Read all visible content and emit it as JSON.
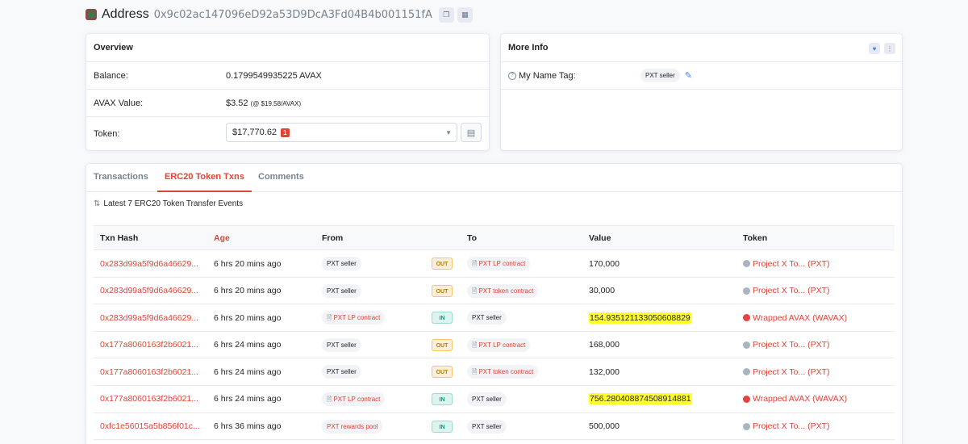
{
  "header": {
    "title": "Address",
    "address": "0x9c02ac147096eD92a53D9DcA3Fd04B4b001151fA"
  },
  "overview": {
    "title": "Overview",
    "balance_label": "Balance:",
    "balance_value": "0.1799549935225 AVAX",
    "avax_value_label": "AVAX Value:",
    "avax_value": "$3.52",
    "avax_rate": "(@ $19.58/AVAX)",
    "token_label": "Token:",
    "token_value": "$17,770.62",
    "token_count": "1"
  },
  "more_info": {
    "title": "More Info",
    "name_tag_label": "My Name Tag:",
    "name_tag_value": "PXT seller"
  },
  "tabs": [
    {
      "label": "Transactions"
    },
    {
      "label": "ERC20 Token Txns",
      "active": true
    },
    {
      "label": "Comments"
    }
  ],
  "latest_text": "Latest 7 ERC20 Token Transfer Events",
  "table": {
    "headers": [
      "Txn Hash",
      "Age",
      "From",
      "To",
      "Value",
      "Token"
    ],
    "rows": [
      {
        "hash": "0x283d99a5f9d6a46629...",
        "age": "6 hrs 20 mins ago",
        "from": "PXT seller",
        "dir": "OUT",
        "to": "PXT LP contract",
        "value": "170,000",
        "token": "Project X To... (PXT)"
      },
      {
        "hash": "0x283d99a5f9d6a46629...",
        "age": "6 hrs 20 mins ago",
        "from": "PXT seller",
        "dir": "OUT",
        "to": "PXT token contract",
        "value": "30,000",
        "token": "Project X To... (PXT)"
      },
      {
        "hash": "0x283d99a5f9d6a46629...",
        "age": "6 hrs 20 mins ago",
        "from": "PXT LP contract",
        "dir": "IN",
        "to": "PXT seller",
        "value": "154.935121133050608829",
        "token": "Wrapped AVAX (WAVAX)"
      },
      {
        "hash": "0x177a8060163f2b6021...",
        "age": "6 hrs 24 mins ago",
        "from": "PXT seller",
        "dir": "OUT",
        "to": "PXT LP contract",
        "value": "168,000",
        "token": "Project X To... (PXT)"
      },
      {
        "hash": "0x177a8060163f2b6021...",
        "age": "6 hrs 24 mins ago",
        "from": "PXT seller",
        "dir": "OUT",
        "to": "PXT token contract",
        "value": "132,000",
        "token": "Project X To... (PXT)"
      },
      {
        "hash": "0x177a8060163f2b6021...",
        "age": "6 hrs 24 mins ago",
        "from": "PXT LP contract",
        "dir": "IN",
        "to": "PXT seller",
        "value": "756.280408874508914881",
        "token": "Wrapped AVAX (WAVAX)"
      },
      {
        "hash": "0xfc1e56015a5b856f01c...",
        "age": "6 hrs 36 mins ago",
        "from": "PXT rewards pool",
        "dir": "IN",
        "to": "PXT seller",
        "value": "500,000",
        "token": "Project X To... (PXT)"
      }
    ]
  }
}
